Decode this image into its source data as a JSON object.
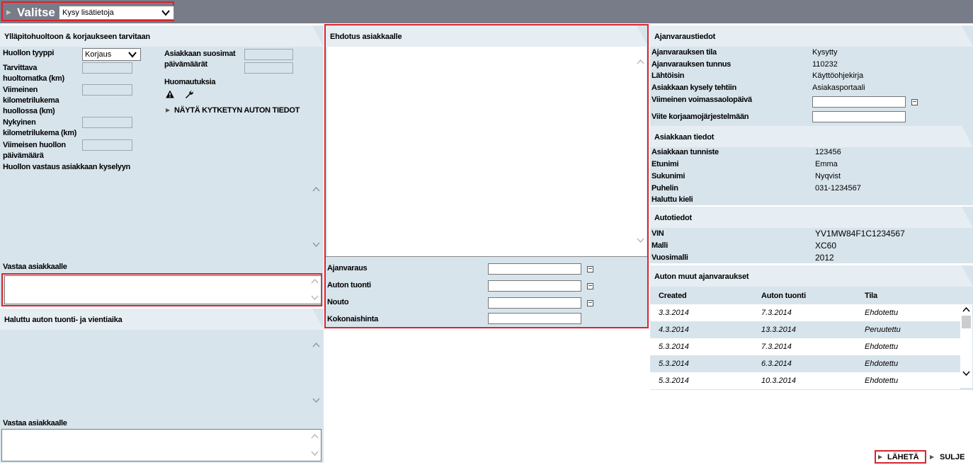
{
  "topbar": {
    "title": "Valitse",
    "select_value": "Kysy lisätietoja"
  },
  "maintenance": {
    "header": "Ylläpitohuoltoon & korjaukseen tarvitaan",
    "service_type_label": "Huollon tyyppi",
    "service_type_value": "Korjaus",
    "required_mileage_label": "Tarvittava huoltomatka (km)",
    "last_mileage_label": "Viimeinen kilometrilukema huollossa (km)",
    "current_mileage_label": "Nykyinen kilometrilukema (km)",
    "last_service_date_label": "Viimeisen huollon päivämäärä",
    "preferred_dates_label": "Asiakkaan suosimat päivämäärät",
    "notes_label": "Huomautuksia",
    "show_car_link": "NÄYTÄ KYTKETYN AUTON TIEDOT",
    "response_label": "Huollon vastaus asiakkaan kyselyyn",
    "reply_label": "Vastaa asiakkaalle"
  },
  "transport": {
    "header": "Haluttu auton tuonti- ja vientiaika",
    "reply_label": "Vastaa asiakkaalle"
  },
  "proposal": {
    "header": "Ehdotus asiakkaalle",
    "booking_label": "Ajanvaraus",
    "car_dropoff_label": "Auton tuonti",
    "pickup_label": "Nouto",
    "total_price_label": "Kokonaishinta"
  },
  "booking_info": {
    "header": "Ajanvaraustiedot",
    "rows": [
      {
        "label": "Ajanvarauksen tila",
        "value": "Kysytty"
      },
      {
        "label": "Ajanvarauksen tunnus",
        "value": "110232"
      },
      {
        "label": "Lähtöisin",
        "value": "Käyttöohjekirja"
      },
      {
        "label": "Asiakkaan kysely tehtiin",
        "value": "Asiakasportaali"
      }
    ],
    "last_valid_label": "Viimeinen voimassaolopäivä",
    "ref_label": "Viite korjaamojärjestelmään"
  },
  "customer_info": {
    "header": "Asiakkaan tiedot",
    "rows": [
      {
        "label": "Asiakkaan tunniste",
        "value": "123456"
      },
      {
        "label": "Etunimi",
        "value": "Emma"
      },
      {
        "label": "Sukunimi",
        "value": "Nyqvist"
      },
      {
        "label": "Puhelin",
        "value": "031-1234567"
      },
      {
        "label": "Haluttu kieli",
        "value": ""
      }
    ]
  },
  "car_info": {
    "header": "Autotiedot",
    "rows": [
      {
        "label": "VIN",
        "value": "YV1MW84F1C1234567"
      },
      {
        "label": "Malli",
        "value": "XC60"
      },
      {
        "label": "Vuosimalli",
        "value": "2012"
      }
    ]
  },
  "other_bookings": {
    "header": "Auton muut ajanvaraukset",
    "columns": [
      "Created",
      "Auton tuonti",
      "Tila"
    ],
    "rows": [
      [
        "3.3.2014",
        "7.3.2014",
        "Ehdotettu"
      ],
      [
        "4.3.2014",
        "13.3.2014",
        "Peruutettu"
      ],
      [
        "5.3.2014",
        "7.3.2014",
        "Ehdotettu"
      ],
      [
        "5.3.2014",
        "6.3.2014",
        "Ehdotettu"
      ],
      [
        "5.3.2014",
        "10.3.2014",
        "Ehdotettu"
      ]
    ]
  },
  "footer": {
    "send_label": "LÄHETÄ",
    "close_label": "SULJE"
  }
}
